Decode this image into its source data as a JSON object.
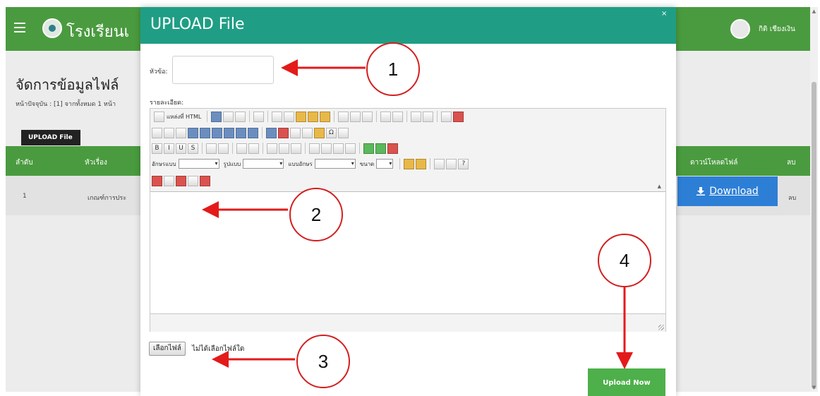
{
  "app": {
    "site_name": "โรงเรียนเ",
    "user_name": "กิติ เชียงเงิน",
    "page_title": "จัดการข้อมูลไฟล์",
    "pager_text": "หน้าปัจจุบัน : [1] จากทั้งหมด 1 หน้า",
    "upload_tab": "UPLOAD File",
    "table": {
      "headers": {
        "no": "ลำดับ",
        "topic": "หัวเรื่อง",
        "download": "ดาวน์โหลดไฟล์",
        "delete": "ลบ"
      },
      "rows": [
        {
          "no": "1",
          "topic": "เกณฑ์การประ",
          "download_label": "Download",
          "delete": "ลบ"
        }
      ]
    }
  },
  "modal": {
    "title": "UPLOAD File",
    "close": "×",
    "topic_label": "หัวข้อ:",
    "topic_value": "",
    "detail_label": "รายละเอียด:",
    "editor": {
      "source_label": "แหล่งที่ HTML",
      "font_label": "อักษรแบบ",
      "format_label": "รูปแบบ",
      "style_label": "แบบอักษร",
      "size_label": "ขนาด",
      "content": ""
    },
    "file_button": "เลือกไฟล์",
    "file_status": "ไม่ได้เลือกไฟล์ใด",
    "upload_button": "Upload Now"
  },
  "callouts": [
    "1",
    "2",
    "3",
    "4"
  ],
  "colors": {
    "header_green": "#4a9b3f",
    "modal_teal": "#1f9e85",
    "download_blue": "#2d7fd6",
    "upload_green": "#4db04a",
    "callout_red": "#d31f1f"
  }
}
